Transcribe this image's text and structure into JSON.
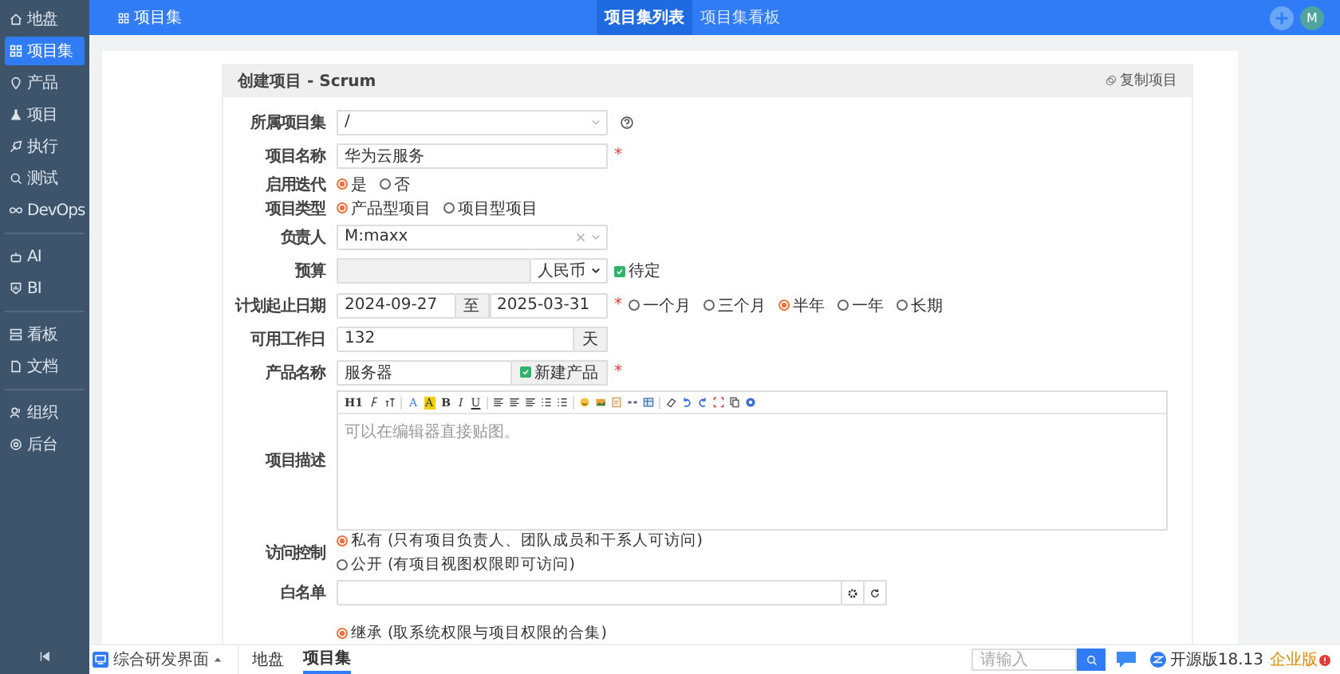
{
  "sidebar": {
    "groups": [
      [
        {
          "label": "地盘",
          "selected": false
        },
        {
          "label": "项目集",
          "selected": true
        },
        {
          "label": "产品",
          "selected": false
        },
        {
          "label": "项目",
          "selected": false
        },
        {
          "label": "执行",
          "selected": false
        },
        {
          "label": "测试",
          "selected": false
        },
        {
          "label": "DevOps",
          "selected": false
        }
      ],
      [
        {
          "label": "AI",
          "selected": false
        },
        {
          "label": "BI",
          "selected": false
        }
      ],
      [
        {
          "label": "看板",
          "selected": false
        },
        {
          "label": "文档",
          "selected": false
        }
      ],
      [
        {
          "label": "组织",
          "selected": false
        },
        {
          "label": "后台",
          "selected": false
        }
      ]
    ]
  },
  "topbar": {
    "breadcrumb": "项目集",
    "tabs": [
      {
        "label": "项目集列表",
        "selected": true
      },
      {
        "label": "项目集看板",
        "selected": false
      }
    ],
    "avatar": "M"
  },
  "panel": {
    "title": "创建项目 - Scrum",
    "action": "复制项目"
  },
  "fields": [
    {
      "kind": "select",
      "label": "所属项目集",
      "value": "/"
    },
    {
      "kind": "text",
      "label": "项目名称",
      "value": "华为云服务",
      "required_mark": "*"
    },
    {
      "kind": "radio",
      "label": "启用迭代",
      "options": [
        {
          "label": "是",
          "selected": true
        },
        {
          "label": "否",
          "selected": false
        }
      ]
    },
    {
      "kind": "radio",
      "label": "项目类型",
      "options": [
        {
          "label": "产品型项目",
          "selected": true
        },
        {
          "label": "项目型项目",
          "selected": false
        }
      ]
    },
    {
      "kind": "person",
      "label": "负责人",
      "value": "M:maxx"
    },
    {
      "kind": "budget",
      "label": "预算",
      "currency": "人民币",
      "checkbox": {
        "label": "待定",
        "checked": true
      }
    },
    {
      "kind": "daterange",
      "label": "计划起止日期",
      "start": "2024-09-27",
      "separator": "至",
      "end": "2025-03-31",
      "required_mark": "*",
      "options": [
        {
          "label": "一个月",
          "selected": false
        },
        {
          "label": "三个月",
          "selected": false
        },
        {
          "label": "半年",
          "selected": true
        },
        {
          "label": "一年",
          "selected": false
        },
        {
          "label": "长期",
          "selected": false
        }
      ]
    },
    {
      "kind": "unit",
      "label": "可用工作日",
      "value": "132",
      "unit": "天"
    },
    {
      "kind": "product",
      "label": "产品名称",
      "value": "服务器",
      "checkbox": {
        "label": "新建产品",
        "checked": true
      },
      "required_mark": "*"
    },
    {
      "kind": "editor",
      "label": "项目描述",
      "placeholder": "可以在编辑器直接贴图。",
      "toolbar_labels": [
        "H1",
        "A",
        "A",
        "B",
        "I",
        "U"
      ]
    },
    {
      "kind": "access",
      "label": "访问控制",
      "options": [
        {
          "label": "私有 (只有项目负责人、团队成员和干系人可访问)",
          "selected": true
        },
        {
          "label": "公开 (有项目视图权限即可访问)",
          "selected": false
        }
      ]
    },
    {
      "kind": "whitelist",
      "label": "白名单"
    },
    {
      "kind": "access",
      "options": [
        {
          "label": "继承 (取系统权限与项目权限的合集)",
          "selected": true
        }
      ]
    }
  ],
  "bottombar": {
    "app": "综合研发界面",
    "tabs": [
      {
        "label": "地盘",
        "selected": false
      },
      {
        "label": "项目集",
        "selected": true
      }
    ],
    "search_placeholder": "请输入",
    "version": "开源版18.13",
    "edition": "企业版"
  }
}
